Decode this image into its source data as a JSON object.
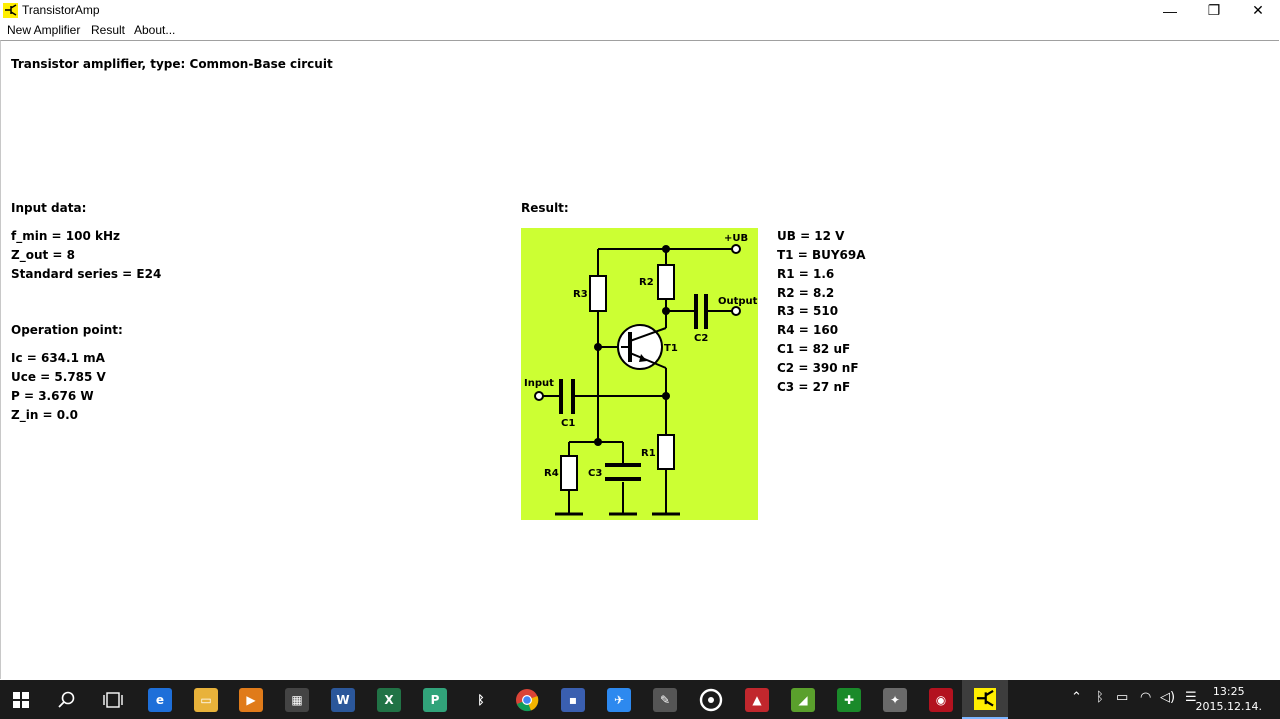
{
  "window": {
    "title": "TransistorAmp",
    "controls": {
      "minimize": "—",
      "restore": "❐",
      "close": "✕"
    }
  },
  "menu": {
    "items": [
      "New Amplifier",
      "Result",
      "About..."
    ]
  },
  "content": {
    "heading": "Transistor amplifier, type: Common-Base circuit",
    "input_title": "Input data:",
    "input_lines": [
      "f_min = 100 kHz",
      "Z_out = 8",
      "Standard series = E24"
    ],
    "op_title": "Operation point:",
    "op_lines": [
      "Ic = 634.1 mA",
      "Uce = 5.785 V",
      "P = 3.676 W",
      "Z_in = 0.0"
    ],
    "result_title": "Result:",
    "result_lines": [
      "UB = 12 V",
      "T1 = BUY69A",
      "R1 = 1.6",
      "R2 = 8.2",
      "R3 = 510",
      "R4 = 160",
      "C1 = 82 uF",
      "C2 = 390 nF",
      "C3 = 27 nF"
    ]
  },
  "schematic": {
    "background": "#ccff33",
    "labels": {
      "ub": "+UB",
      "output": "Output",
      "input": "Input",
      "r1": "R1",
      "r2": "R2",
      "r3": "R3",
      "r4": "R4",
      "c1": "C1",
      "c2": "C2",
      "c3": "C3",
      "t1": "T1"
    }
  },
  "taskbar": {
    "time": "13:25",
    "date": "2015.12.14."
  }
}
